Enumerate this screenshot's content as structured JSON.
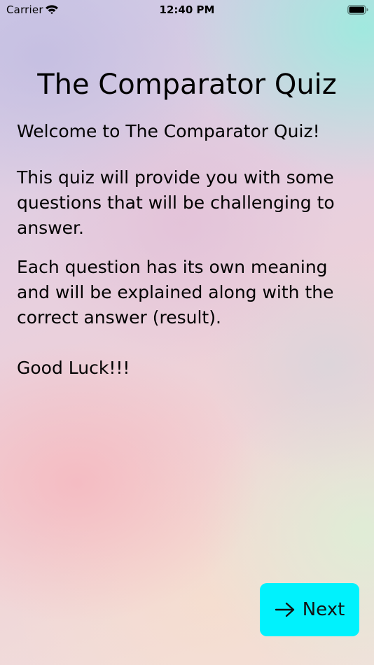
{
  "status_bar": {
    "carrier": "Carrier",
    "time": "12:40 PM",
    "icons": [
      "wifi-icon",
      "battery-icon"
    ]
  },
  "screen": {
    "title": "The Comparator Quiz",
    "paragraphs": {
      "welcome": "Welcome to The Comparator Quiz!",
      "intro": "This quiz will provide you with some questions that will be challenging to answer.",
      "detail": "Each question has its own meaning and will be explained along with the correct answer (result).",
      "closing": "Good Luck!!!"
    }
  },
  "next_button": {
    "label": "Next",
    "icon": "arrow-right-icon",
    "color": "#00f2fd"
  },
  "colors": {
    "text": "#000000",
    "accent": "#00f2fd"
  }
}
